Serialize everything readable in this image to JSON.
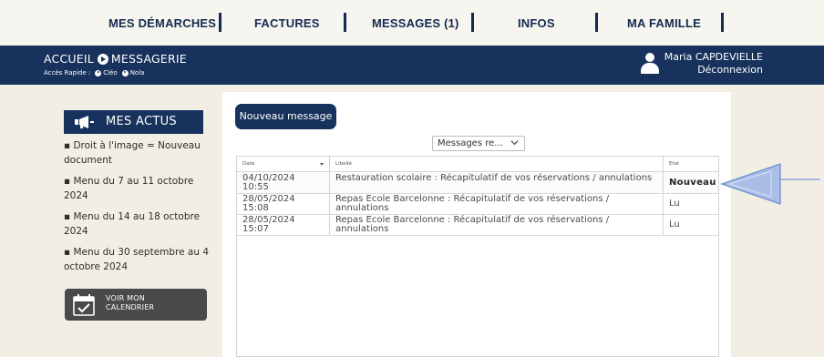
{
  "nav": {
    "items": [
      "MES DÉMARCHES",
      "FACTURES",
      "MESSAGES (1)",
      "INFOS",
      "MA FAMILLE"
    ]
  },
  "header": {
    "breadcrumb_home": "ACCUEIL",
    "breadcrumb_current": "MESSAGERIE",
    "quick_access_label": "Accès Rapide :",
    "quick_links": [
      "Cléo",
      "Nola"
    ],
    "user_name": "Maria CAPDEVIELLE",
    "logout": "Déconnexion"
  },
  "sidebar": {
    "title": "MES ACTUS",
    "news": [
      "▪ Droit à l'image = Nouveau document",
      "▪ Menu du 7 au 11 octobre 2024",
      "▪ Menu du 14 au 18 octobre 2024",
      "▪ Menu du 30 septembre au 4 octobre 2024"
    ],
    "calendar_button": [
      "VOIR MON",
      "CALENDRIER"
    ]
  },
  "main": {
    "new_message_button": "Nouveau message",
    "filter_value": "Messages re...",
    "columns": [
      "Date",
      "Libellé",
      "Etat"
    ],
    "rows": [
      {
        "date": "04/10/2024\n10:55",
        "label": "Restauration scolaire : Récapitulatif de vos réservations / annulations",
        "state": "Nouveau"
      },
      {
        "date": "28/05/2024\n15:08",
        "label": "Repas Ecole Barcelonne : Récapitulatif de vos réservations / annulations",
        "state": "Lu"
      },
      {
        "date": "28/05/2024\n15:07",
        "label": "Repas Ecole Barcelonne : Récapitulatif de vos réservations / annulations",
        "state": "Lu"
      }
    ]
  },
  "colors": {
    "navy": "#17325c",
    "background": "#f3eee4",
    "arrow": "#a9bde6"
  },
  "icons": {
    "breadcrumb_separator": "circle-arrow-icon",
    "user": "user-icon",
    "actus": "megaphone-icon",
    "calendar": "calendar-check-icon",
    "filter": "chevron-down-icon",
    "annotation": "arrow-left-icon"
  }
}
